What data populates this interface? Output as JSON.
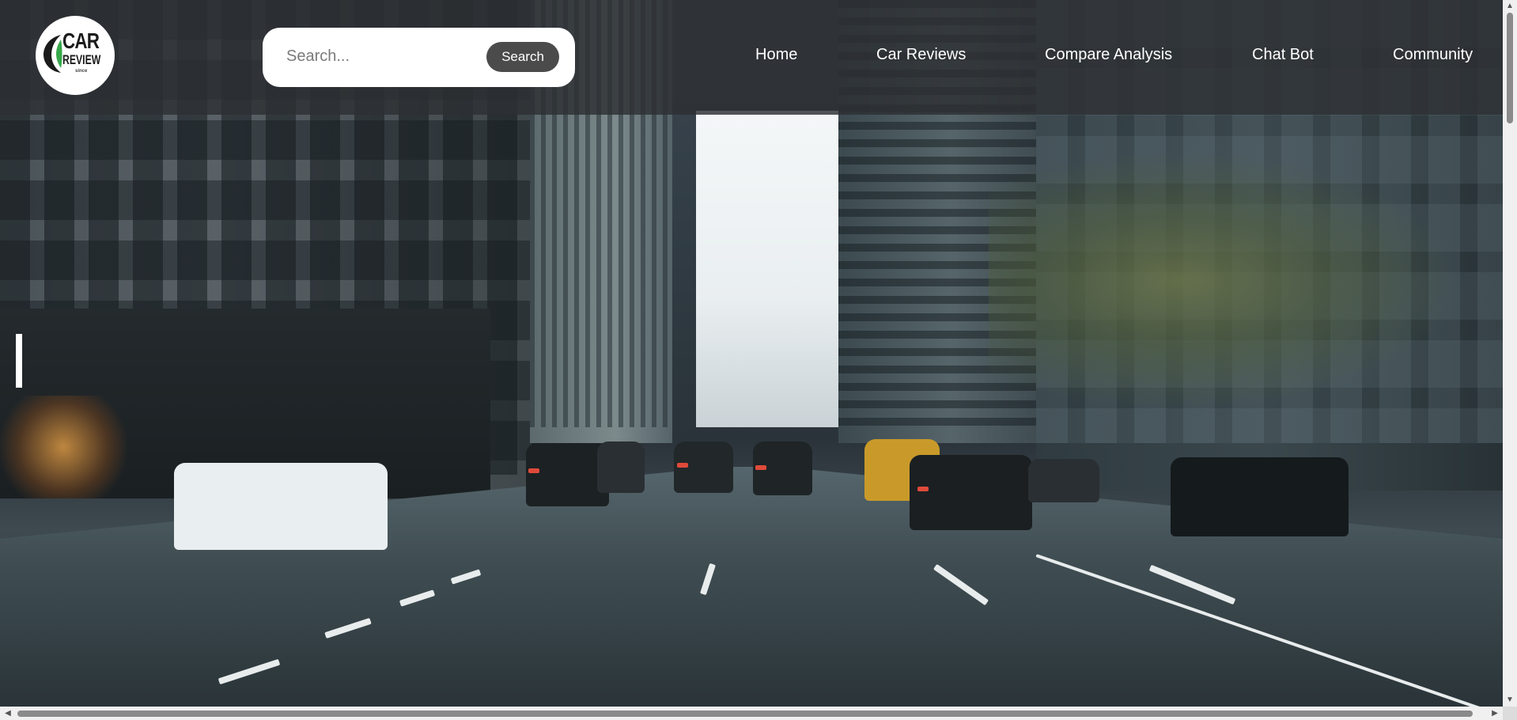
{
  "logo": {
    "line1": "CAR",
    "line2": "REVIEW",
    "line3": "since"
  },
  "search": {
    "placeholder": "Search...",
    "button_label": "Search"
  },
  "nav": {
    "items": [
      {
        "label": "Home"
      },
      {
        "label": "Car Reviews"
      },
      {
        "label": "Compare Analysis"
      },
      {
        "label": "Chat Bot"
      },
      {
        "label": "Community"
      }
    ]
  },
  "hero": {
    "image_subject": "city street with traffic",
    "accent_color": "#2d3033"
  },
  "colors": {
    "header_bg": "#2d3033",
    "search_button": "#4b4b4b",
    "nav_text": "#ffffff"
  }
}
